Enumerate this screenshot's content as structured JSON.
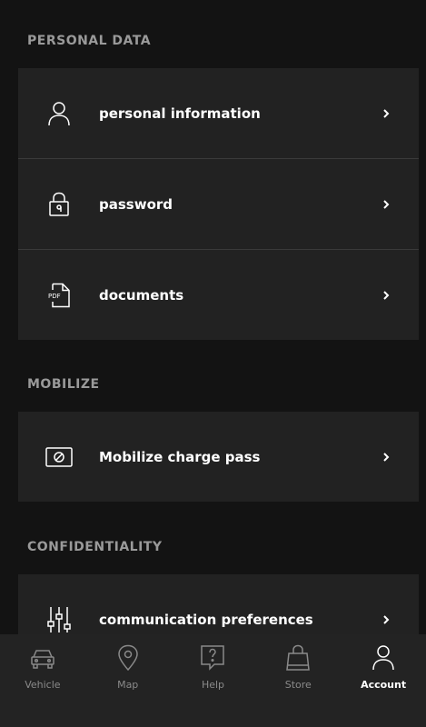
{
  "sections": {
    "personal": {
      "title": "PERSONAL DATA",
      "items": [
        {
          "label": "personal information",
          "icon": "person-icon"
        },
        {
          "label": "password",
          "icon": "lock-icon"
        },
        {
          "label": "documents",
          "icon": "pdf-document-icon"
        }
      ]
    },
    "mobilize": {
      "title": "MOBILIZE",
      "items": [
        {
          "label": "Mobilize charge pass",
          "icon": "charge-card-icon"
        }
      ]
    },
    "confidentiality": {
      "title": "CONFIDENTIALITY",
      "items": [
        {
          "label": "communication preferences",
          "icon": "sliders-icon"
        }
      ]
    }
  },
  "nav": {
    "items": [
      {
        "label": "Vehicle",
        "icon": "car-icon"
      },
      {
        "label": "Map",
        "icon": "map-pin-icon"
      },
      {
        "label": "Help",
        "icon": "help-icon"
      },
      {
        "label": "Store",
        "icon": "shopping-bag-icon"
      },
      {
        "label": "Account",
        "icon": "account-icon"
      }
    ],
    "active": "Account"
  },
  "colors": {
    "background": "#131313",
    "card": "#222222",
    "section_title": "#9a9a9a",
    "nav_inactive": "#8a8a8a",
    "nav_active": "#ffffff"
  }
}
